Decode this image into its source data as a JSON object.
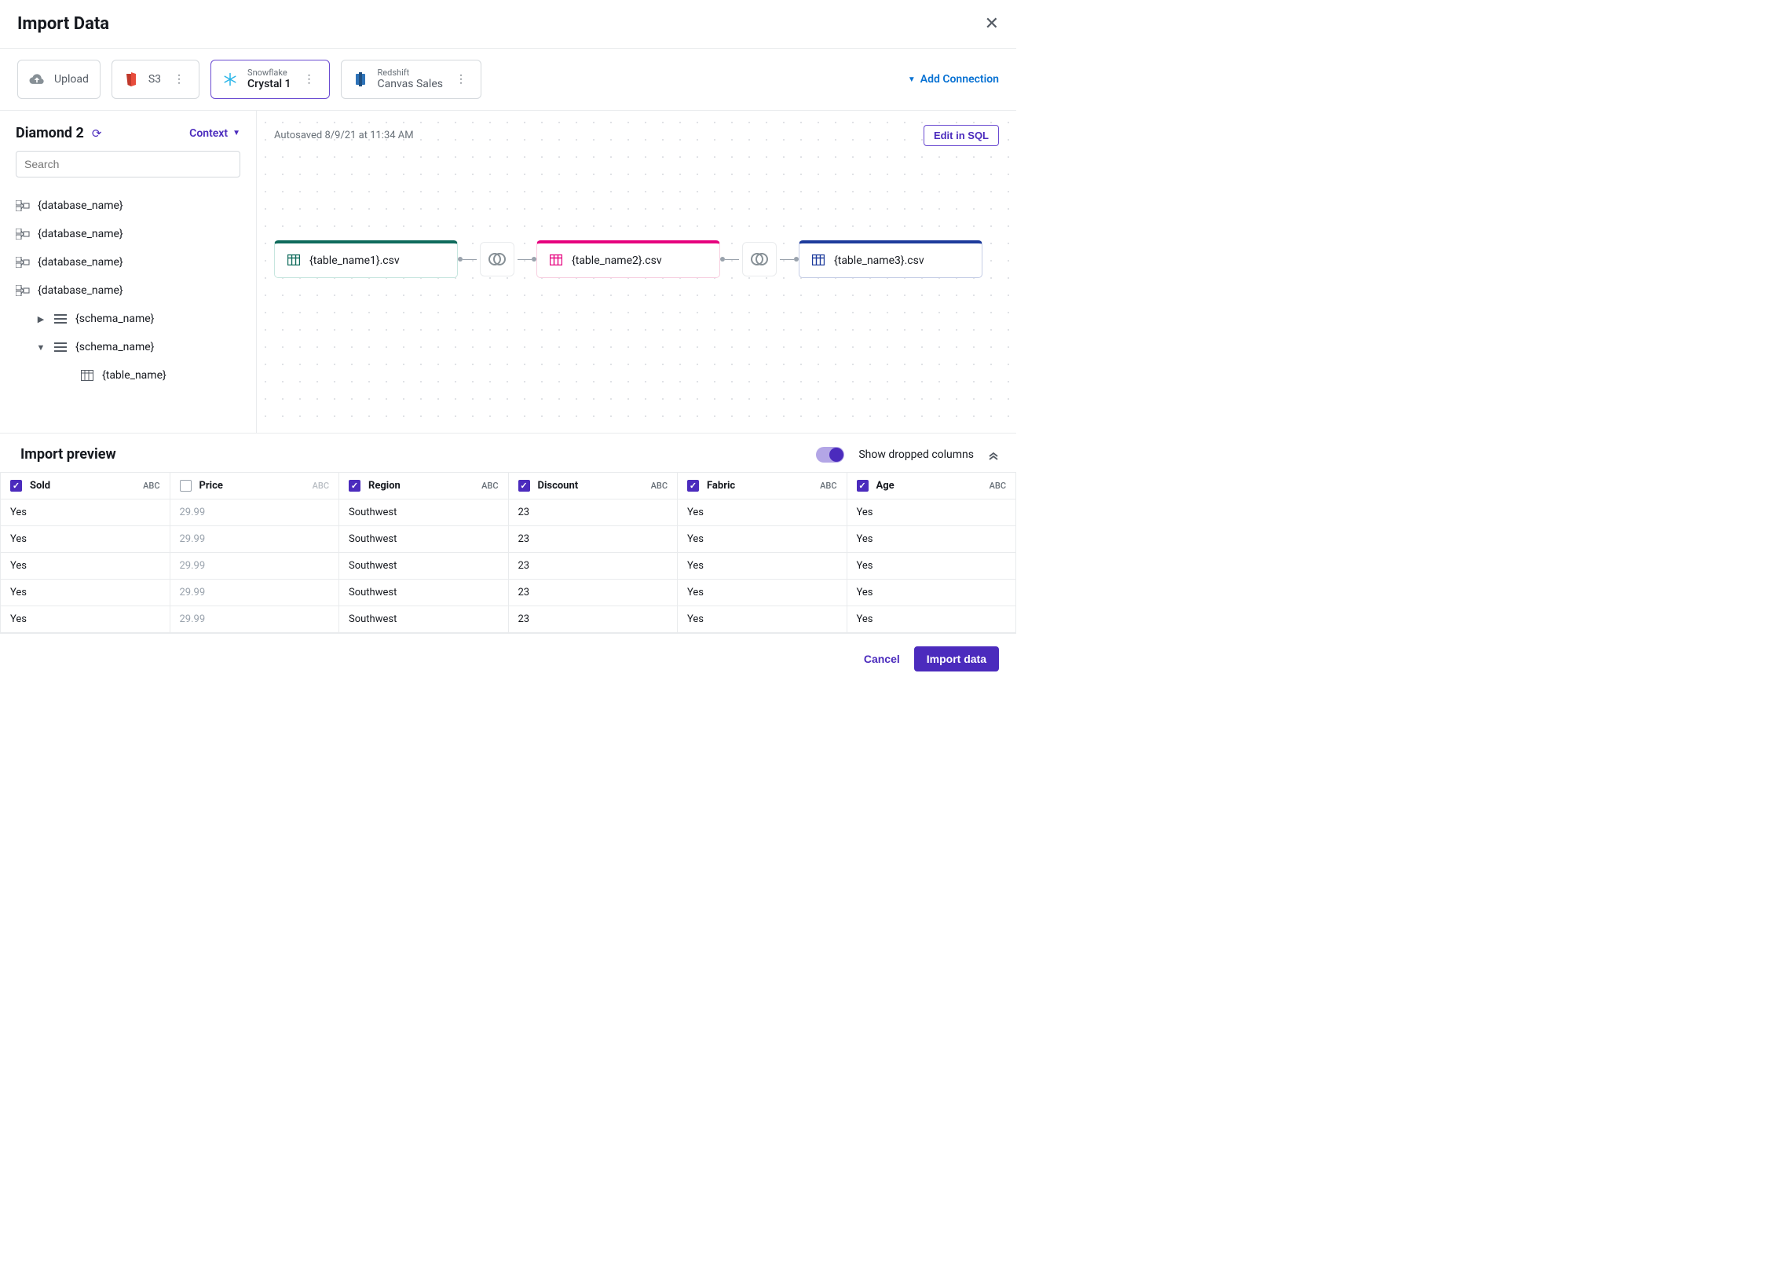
{
  "header": {
    "title": "Import Data"
  },
  "connections": {
    "upload_label": "Upload",
    "s3_label": "S3",
    "snowflake_small": "Snowflake",
    "snowflake_big": "Crystal 1",
    "redshift_small": "Redshift",
    "redshift_big": "Canvas Sales",
    "add_connection": "Add Connection"
  },
  "sidebar": {
    "title": "Diamond 2",
    "context_label": "Context",
    "search_placeholder": "Search",
    "db1": "{database_name}",
    "db2": "{database_name}",
    "db3": "{database_name}",
    "db4": "{database_name}",
    "schema1": "{schema_name}",
    "schema2": "{schema_name}",
    "table1": "{table_name}"
  },
  "canvas": {
    "autosaved": "Autosaved 8/9/21 at 11:34 AM",
    "edit_sql": "Edit in SQL",
    "node1": "{table_name1}.csv",
    "node2": "{table_name2}.csv",
    "node3": "{table_name3}.csv"
  },
  "preview": {
    "title": "Import preview",
    "show_dropped": "Show dropped columns",
    "columns": [
      {
        "name": "Sold",
        "type": "ABC",
        "checked": true
      },
      {
        "name": "Price",
        "type": "ABC",
        "checked": false
      },
      {
        "name": "Region",
        "type": "ABC",
        "checked": true
      },
      {
        "name": "Discount",
        "type": "ABC",
        "checked": true
      },
      {
        "name": "Fabric",
        "type": "ABC",
        "checked": true
      },
      {
        "name": "Age",
        "type": "ABC",
        "checked": true
      }
    ],
    "rows": [
      [
        "Yes",
        "29.99",
        "Southwest",
        "23",
        "Yes",
        "Yes"
      ],
      [
        "Yes",
        "29.99",
        "Southwest",
        "23",
        "Yes",
        "Yes"
      ],
      [
        "Yes",
        "29.99",
        "Southwest",
        "23",
        "Yes",
        "Yes"
      ],
      [
        "Yes",
        "29.99",
        "Southwest",
        "23",
        "Yes",
        "Yes"
      ],
      [
        "Yes",
        "29.99",
        "Southwest",
        "23",
        "Yes",
        "Yes"
      ]
    ]
  },
  "footer": {
    "cancel": "Cancel",
    "import": "Import data"
  }
}
